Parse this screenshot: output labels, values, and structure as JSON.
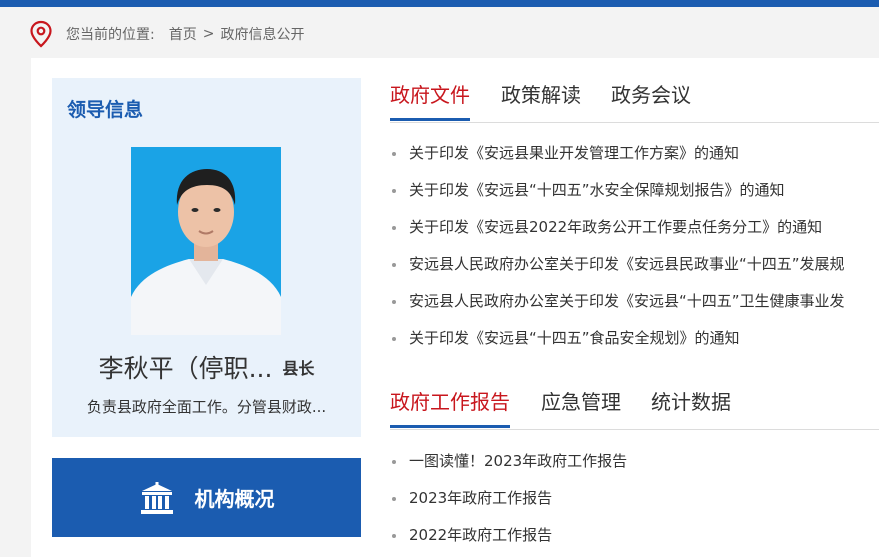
{
  "breadcrumb": {
    "label": "您当前的位置:",
    "home": "首页",
    "separator": ">",
    "current": "政府信息公开"
  },
  "leader": {
    "section_title": "领导信息",
    "name": "李秋平（停职...",
    "position": "县长",
    "duty": "负责县政府全面工作。分管县财政..."
  },
  "org_button": {
    "label": "机构概况"
  },
  "tabs_top": [
    {
      "label": "政府文件",
      "active": true
    },
    {
      "label": "政策解读",
      "active": false
    },
    {
      "label": "政务会议",
      "active": false
    }
  ],
  "docs": [
    "关于印发《安远县果业开发管理工作方案》的通知",
    "关于印发《安远县“十四五”水安全保障规划报告》的通知",
    "关于印发《安远县2022年政务公开工作要点任务分工》的通知",
    "安远县人民政府办公室关于印发《安远县民政事业“十四五”发展规",
    "安远县人民政府办公室关于印发《安远县“十四五”卫生健康事业发",
    "关于印发《安远县“十四五”食品安全规划》的通知"
  ],
  "tabs_bottom": [
    {
      "label": "政府工作报告",
      "active": true
    },
    {
      "label": "应急管理",
      "active": false
    },
    {
      "label": "统计数据",
      "active": false
    }
  ],
  "reports": [
    "一图读懂！2023年政府工作报告",
    "2023年政府工作报告",
    "2022年政府工作报告"
  ],
  "colors": {
    "brand_blue": "#1b5cb0",
    "active_red": "#c8161d",
    "photo_bg": "#1aa3e6"
  },
  "icons": {
    "location": "location-pin-icon",
    "org": "government-building-icon"
  }
}
